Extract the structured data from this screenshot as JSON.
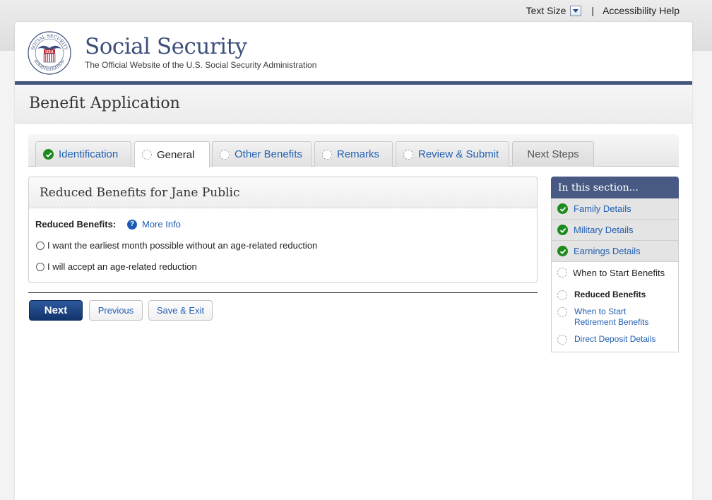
{
  "utility": {
    "text_size_label": "Text Size",
    "separator": "|",
    "accessibility_help": "Accessibility Help"
  },
  "header": {
    "logo_text_top": "SOCIAL SECURITY",
    "logo_text_bottom": "ADMINISTRATION",
    "logo_badge": "USA",
    "site_title": "Social Security",
    "tagline": "The Official Website of the U.S. Social Security Administration"
  },
  "page": {
    "title": "Benefit Application"
  },
  "tabs": [
    {
      "label": "Identification",
      "status": "complete"
    },
    {
      "label": "General",
      "status": "current"
    },
    {
      "label": "Other Benefits",
      "status": "pending"
    },
    {
      "label": "Remarks",
      "status": "pending"
    },
    {
      "label": "Review & Submit",
      "status": "pending"
    },
    {
      "label": "Next Steps",
      "status": "disabled"
    }
  ],
  "panel": {
    "title": "Reduced Benefits for Jane Public",
    "field_label": "Reduced Benefits:",
    "more_info": "More Info",
    "options": [
      {
        "label": "I want the earliest month possible without an age-related reduction",
        "selected": false
      },
      {
        "label": "I will accept an age-related reduction",
        "selected": false
      }
    ]
  },
  "buttons": {
    "next": "Next",
    "previous": "Previous",
    "save_exit": "Save & Exit"
  },
  "side_nav": {
    "heading": "In this section...",
    "items": [
      {
        "label": "Family Details",
        "status": "complete"
      },
      {
        "label": "Military Details",
        "status": "complete"
      },
      {
        "label": "Earnings Details",
        "status": "complete"
      },
      {
        "label": "When to Start Benefits",
        "status": "current"
      }
    ],
    "sub_items": [
      {
        "label": "Reduced Benefits",
        "active": true
      },
      {
        "label": "When to Start Retirement Benefits",
        "active": false
      },
      {
        "label": "Direct Deposit Details",
        "active": false
      }
    ]
  },
  "colors": {
    "brand_navy": "#46577e",
    "link_blue": "#2260b2",
    "check_green": "#1d8a1d",
    "primary_button": "#12336b"
  }
}
